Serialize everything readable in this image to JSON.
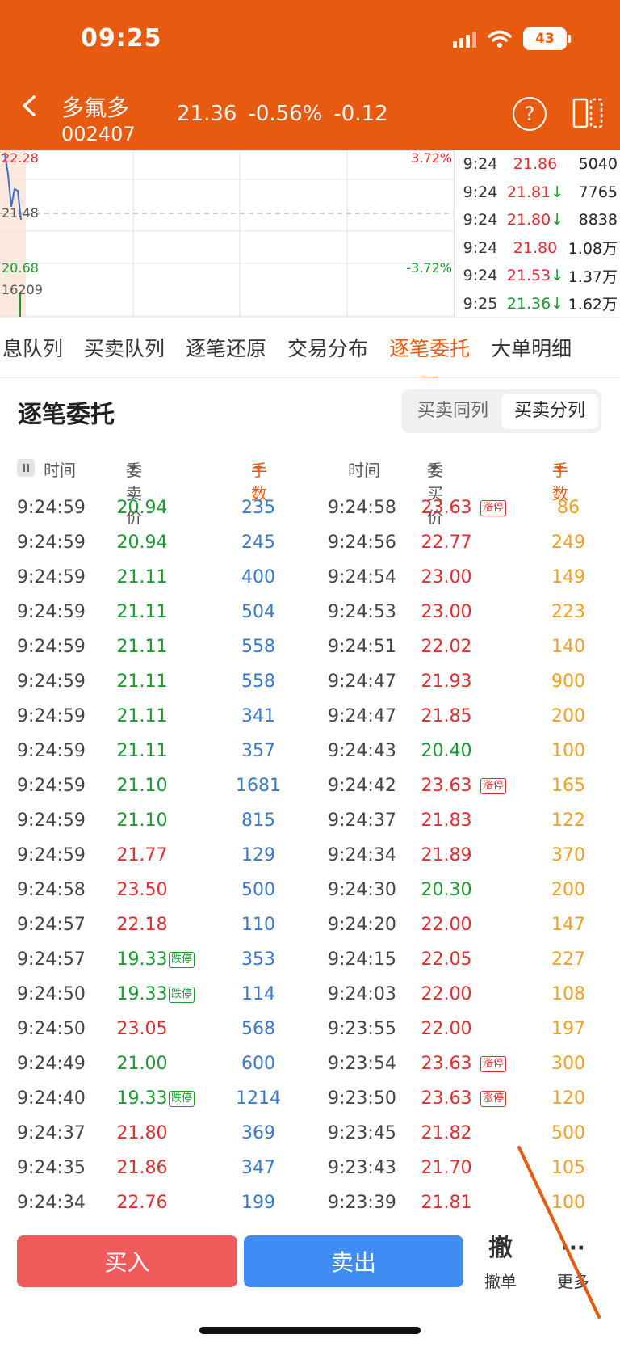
{
  "status_bar": {
    "time": "09:25",
    "battery": "43"
  },
  "header": {
    "name": "多氟多",
    "code": "002407",
    "price": "21.36",
    "change_pct": "-0.56%",
    "change": "-0.12",
    "help_glyph": "?"
  },
  "chart": {
    "price_high": "22.28",
    "pct_high": "3.72%",
    "price_mid": "21.48",
    "price_low": "20.68",
    "pct_low": "-3.72%",
    "volume": "16209",
    "colors": {
      "up": "#e02e2e",
      "down": "#1a9a2c",
      "line": "#3a6fd0"
    }
  },
  "ticks": [
    {
      "time": "9:24",
      "price": "21.86",
      "arrow": "",
      "vol": "5040",
      "color": "red"
    },
    {
      "time": "9:24",
      "price": "21.81",
      "arrow": "↓",
      "vol": "7765",
      "color": "red"
    },
    {
      "time": "9:24",
      "price": "21.80",
      "arrow": "↓",
      "vol": "8838",
      "color": "red"
    },
    {
      "time": "9:24",
      "price": "21.80",
      "arrow": "",
      "vol": "1.08万",
      "color": "red"
    },
    {
      "time": "9:24",
      "price": "21.53",
      "arrow": "↓",
      "vol": "1.37万",
      "color": "red"
    },
    {
      "time": "9:25",
      "price": "21.36",
      "arrow": "↓",
      "vol": "1.62万",
      "color": "green"
    }
  ],
  "tabs": [
    {
      "label": "息队列",
      "active": false
    },
    {
      "label": "买卖队列",
      "active": false
    },
    {
      "label": "逐笔还原",
      "active": false
    },
    {
      "label": "交易分布",
      "active": false
    },
    {
      "label": "逐笔委托",
      "active": true
    },
    {
      "label": "大单明细",
      "active": false
    }
  ],
  "section": {
    "title": "逐笔委托",
    "segment": [
      "买卖同列",
      "买卖分列"
    ],
    "segment_selected": "买卖分列"
  },
  "columns": {
    "time1": "时间",
    "sell_price": "委卖价",
    "qty1": "手数",
    "time2": "时间",
    "buy_price": "委买价",
    "qty2": "手数"
  },
  "rows": [
    {
      "t1": "9:24:59",
      "p1": "20.94",
      "c1": "green",
      "b1": "",
      "q1": "235",
      "t2": "9:24:58",
      "p2": "23.63",
      "c2": "red",
      "b2": "涨停",
      "q2": "86"
    },
    {
      "t1": "9:24:59",
      "p1": "20.94",
      "c1": "green",
      "b1": "",
      "q1": "245",
      "t2": "9:24:56",
      "p2": "22.77",
      "c2": "red",
      "b2": "",
      "q2": "249"
    },
    {
      "t1": "9:24:59",
      "p1": "21.11",
      "c1": "green",
      "b1": "",
      "q1": "400",
      "t2": "9:24:54",
      "p2": "23.00",
      "c2": "red",
      "b2": "",
      "q2": "149"
    },
    {
      "t1": "9:24:59",
      "p1": "21.11",
      "c1": "green",
      "b1": "",
      "q1": "504",
      "t2": "9:24:53",
      "p2": "23.00",
      "c2": "red",
      "b2": "",
      "q2": "223"
    },
    {
      "t1": "9:24:59",
      "p1": "21.11",
      "c1": "green",
      "b1": "",
      "q1": "558",
      "t2": "9:24:51",
      "p2": "22.02",
      "c2": "red",
      "b2": "",
      "q2": "140"
    },
    {
      "t1": "9:24:59",
      "p1": "21.11",
      "c1": "green",
      "b1": "",
      "q1": "558",
      "t2": "9:24:47",
      "p2": "21.93",
      "c2": "red",
      "b2": "",
      "q2": "900"
    },
    {
      "t1": "9:24:59",
      "p1": "21.11",
      "c1": "green",
      "b1": "",
      "q1": "341",
      "t2": "9:24:47",
      "p2": "21.85",
      "c2": "red",
      "b2": "",
      "q2": "200"
    },
    {
      "t1": "9:24:59",
      "p1": "21.11",
      "c1": "green",
      "b1": "",
      "q1": "357",
      "t2": "9:24:43",
      "p2": "20.40",
      "c2": "green",
      "b2": "",
      "q2": "100"
    },
    {
      "t1": "9:24:59",
      "p1": "21.10",
      "c1": "green",
      "b1": "",
      "q1": "1681",
      "t2": "9:24:42",
      "p2": "23.63",
      "c2": "red",
      "b2": "涨停",
      "q2": "165"
    },
    {
      "t1": "9:24:59",
      "p1": "21.10",
      "c1": "green",
      "b1": "",
      "q1": "815",
      "t2": "9:24:37",
      "p2": "21.83",
      "c2": "red",
      "b2": "",
      "q2": "122"
    },
    {
      "t1": "9:24:59",
      "p1": "21.77",
      "c1": "red",
      "b1": "",
      "q1": "129",
      "t2": "9:24:34",
      "p2": "21.89",
      "c2": "red",
      "b2": "",
      "q2": "370"
    },
    {
      "t1": "9:24:58",
      "p1": "23.50",
      "c1": "red",
      "b1": "",
      "q1": "500",
      "t2": "9:24:30",
      "p2": "20.30",
      "c2": "green",
      "b2": "",
      "q2": "200"
    },
    {
      "t1": "9:24:57",
      "p1": "22.18",
      "c1": "red",
      "b1": "",
      "q1": "110",
      "t2": "9:24:20",
      "p2": "22.00",
      "c2": "red",
      "b2": "",
      "q2": "147"
    },
    {
      "t1": "9:24:57",
      "p1": "19.33",
      "c1": "green",
      "b1": "跌停",
      "q1": "353",
      "t2": "9:24:15",
      "p2": "22.05",
      "c2": "red",
      "b2": "",
      "q2": "227"
    },
    {
      "t1": "9:24:50",
      "p1": "19.33",
      "c1": "green",
      "b1": "跌停",
      "q1": "114",
      "t2": "9:24:03",
      "p2": "22.00",
      "c2": "red",
      "b2": "",
      "q2": "108"
    },
    {
      "t1": "9:24:50",
      "p1": "23.05",
      "c1": "red",
      "b1": "",
      "q1": "568",
      "t2": "9:23:55",
      "p2": "22.00",
      "c2": "red",
      "b2": "",
      "q2": "197"
    },
    {
      "t1": "9:24:49",
      "p1": "21.00",
      "c1": "green",
      "b1": "",
      "q1": "600",
      "t2": "9:23:54",
      "p2": "23.63",
      "c2": "red",
      "b2": "涨停",
      "q2": "300"
    },
    {
      "t1": "9:24:40",
      "p1": "19.33",
      "c1": "green",
      "b1": "跌停",
      "q1": "1214",
      "t2": "9:23:50",
      "p2": "23.63",
      "c2": "red",
      "b2": "涨停",
      "q2": "120"
    },
    {
      "t1": "9:24:37",
      "p1": "21.80",
      "c1": "red",
      "b1": "",
      "q1": "369",
      "t2": "9:23:45",
      "p2": "21.82",
      "c2": "red",
      "b2": "",
      "q2": "500"
    },
    {
      "t1": "9:24:35",
      "p1": "21.86",
      "c1": "red",
      "b1": "",
      "q1": "347",
      "t2": "9:23:43",
      "p2": "21.70",
      "c2": "red",
      "b2": "",
      "q2": "105"
    },
    {
      "t1": "9:24:34",
      "p1": "22.76",
      "c1": "red",
      "b1": "",
      "q1": "199",
      "t2": "9:23:39",
      "p2": "21.81",
      "c2": "red",
      "b2": "",
      "q2": "100"
    }
  ],
  "bottom": {
    "buy": "买入",
    "sell": "卖出",
    "cancel_glyph": "撤",
    "cancel": "撤单",
    "more_glyph": "···",
    "more": "更多"
  }
}
